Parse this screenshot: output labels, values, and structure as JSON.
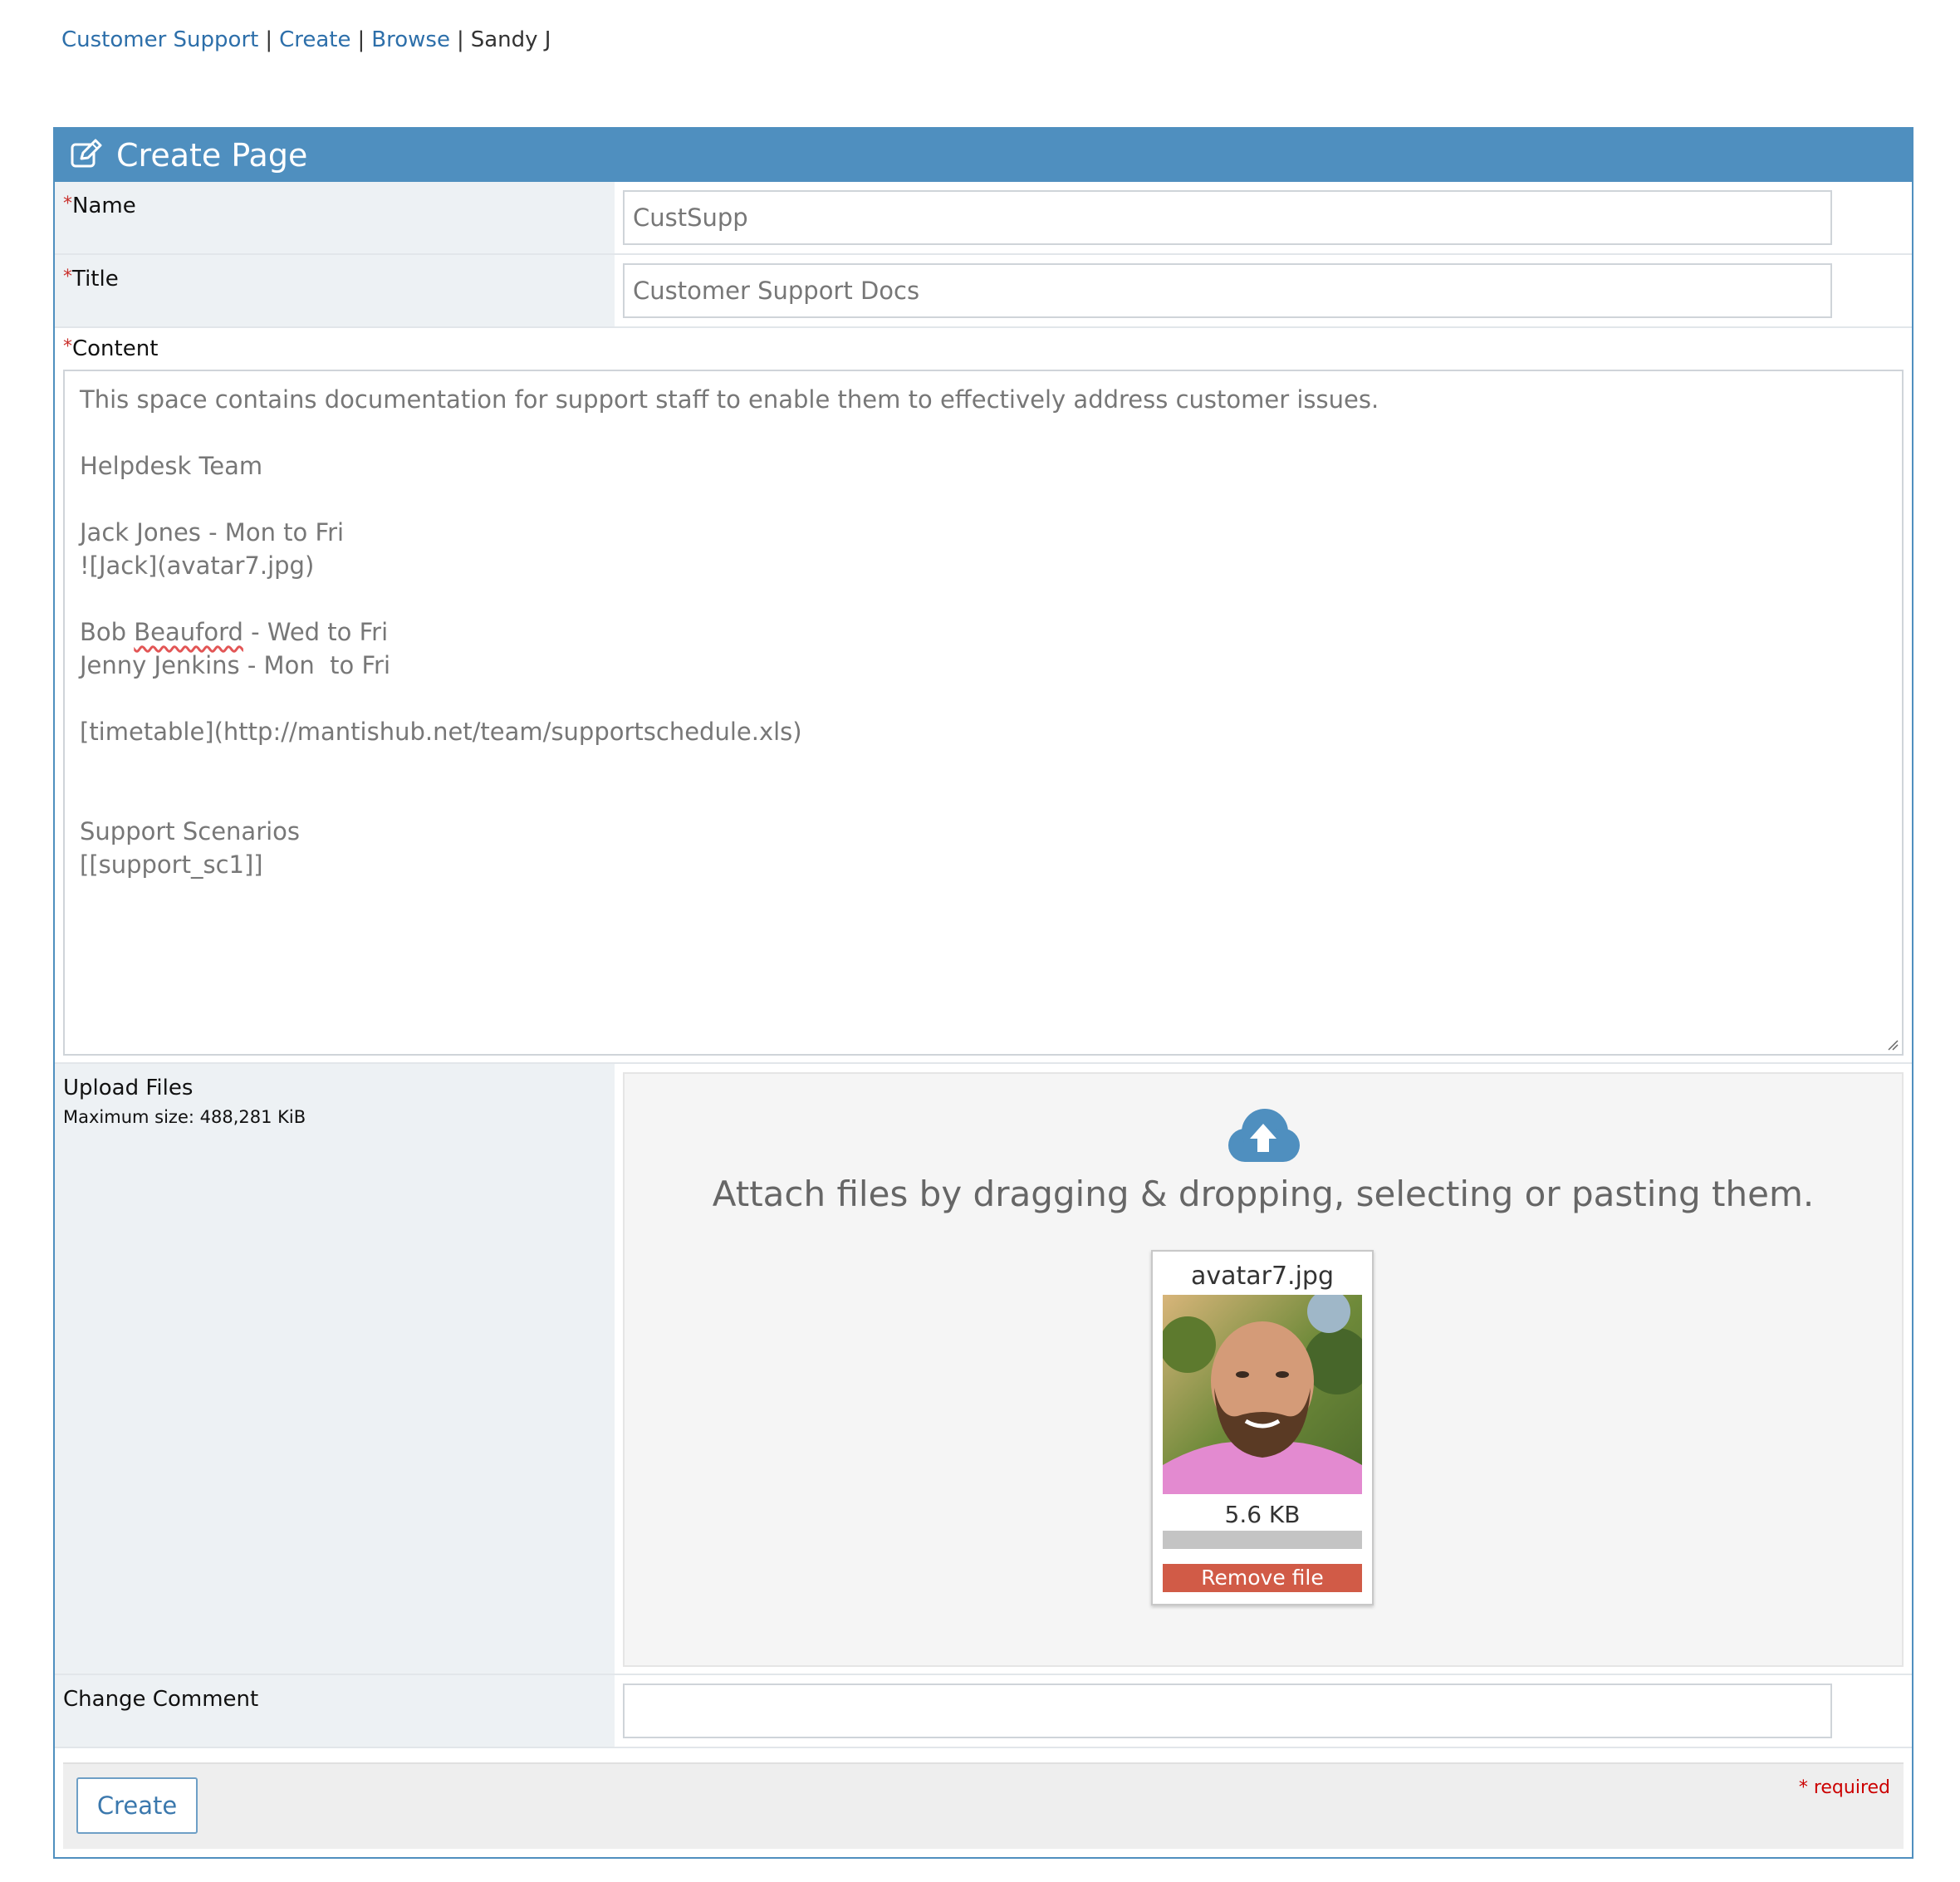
{
  "breadcrumbs": {
    "project": "Customer Support",
    "create": "Create",
    "browse": "Browse",
    "user": "Sandy J",
    "separator": "|"
  },
  "header": {
    "icon": "edit-icon",
    "title": "Create Page"
  },
  "form": {
    "required_mark": "*",
    "name": {
      "label": "Name",
      "value": "CustSupp"
    },
    "title": {
      "label": "Title",
      "value": "Customer Support Docs"
    },
    "content": {
      "label": "Content",
      "lines": [
        "This space contains documentation for support staff to enable them to effectively address customer issues.",
        "Helpdesk Team",
        "Jack Jones - Mon to Fri",
        "![Jack](avatar7.jpg)",
        "Bob ",
        "Beauford",
        " - Wed to Fri",
        "Jenny Jenkins - Mon  to Fri",
        "[timetable](http://mantishub.net/team/supportschedule.xls)",
        "Support Scenarios",
        "[[support_sc1]]"
      ]
    },
    "upload": {
      "label": "Upload Files",
      "max_size": "Maximum size: 488,281 KiB",
      "icon": "cloud-upload-icon",
      "drop_text": "Attach files by dragging & dropping, selecting or pasting them.",
      "file": {
        "name": "avatar7.jpg",
        "size": "5.6 KB",
        "progress": 0,
        "remove_label": "Remove file"
      }
    },
    "comment": {
      "label": "Change Comment",
      "value": ""
    },
    "submit_label": "Create",
    "required_note": "* required"
  },
  "colors": {
    "accent": "#4f8fbf",
    "link": "#2d6faa",
    "required": "#c9302c",
    "remove_button": "#d15b47"
  }
}
